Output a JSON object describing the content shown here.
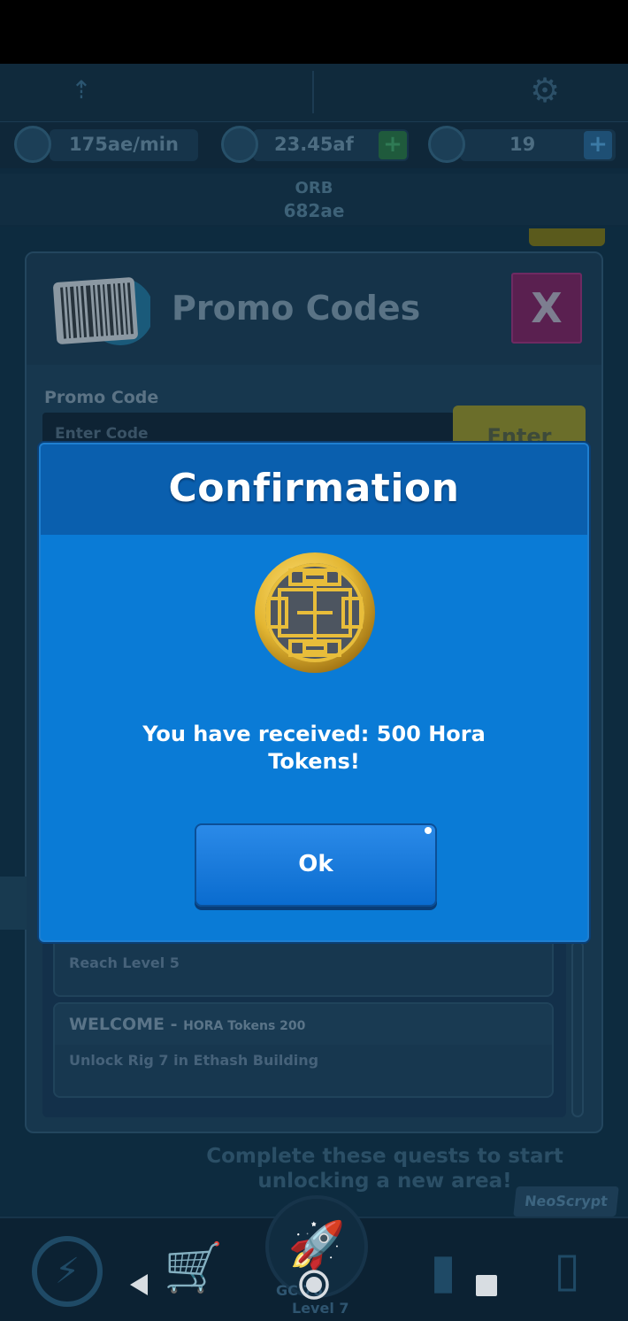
{
  "top_bar": {
    "stats": [
      {
        "icon": "ae-rate-icon",
        "value": "175ae/min"
      },
      {
        "icon": "hora-coin-icon",
        "value": "23.45af"
      },
      {
        "icon": "gem-stack-icon",
        "value": "19"
      }
    ],
    "orb": {
      "label": "ORB",
      "value": "682ae"
    }
  },
  "promo_panel": {
    "title": "Promo Codes",
    "close_label": "X",
    "code_label": "Promo Code",
    "code_placeholder": "Enter Code",
    "enter_label": "Enter",
    "items": [
      {
        "title": "",
        "subtitle": "",
        "desc": "Reach Level 5"
      },
      {
        "title": "WELCOME - ",
        "subtitle": "HORA Tokens 200",
        "desc": "Unlock Rig 7 in Ethash Building"
      }
    ]
  },
  "dialog": {
    "title": "Confirmation",
    "message": "You have received: 500 Hora Tokens!",
    "ok_label": "Ok",
    "icon": "hora-token-icon"
  },
  "background": {
    "quest_text": "Complete these quests to start unlocking a new area!",
    "brand_badge": "NeoScrypt",
    "nav_center_label": "GC 76",
    "nav_center_level": "Level 7"
  },
  "colors": {
    "dialog_blue": "#0a7bd6",
    "dialog_header": "#0a5fae",
    "coin_gold": "#e3b632"
  }
}
